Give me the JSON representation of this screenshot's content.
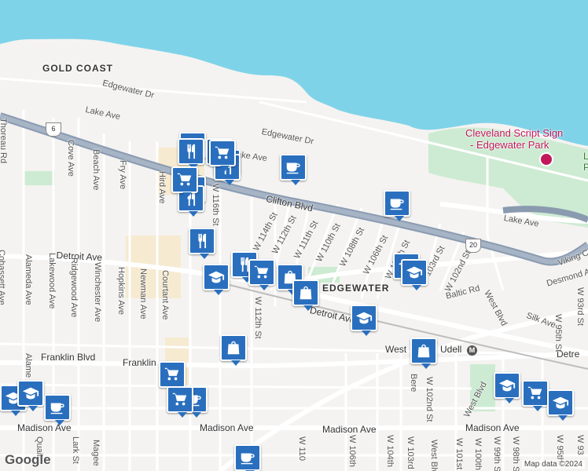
{
  "map": {
    "neighborhoods": [
      "GOLD COAST",
      "EDGEWATER"
    ],
    "poi": {
      "name": "Cleveland Script Sign - Edgewater Park",
      "line1": "Cleveland Script Sign",
      "line2": "- Edgewater Park"
    },
    "streets": {
      "edgewater_dr_1": "Edgewater Dr",
      "edgewater_dr_2": "Edgewater Dr",
      "lake_ave_1": "Lake Ave",
      "lake_ave_2": "Lake Ave",
      "lake_ave_3": "Lake Ave",
      "clifton_blvd": "Clifton Blvd",
      "detroit_ave_1": "Detroit Ave",
      "detroit_ave_2": "Detroit Ave",
      "detroit_ave_3": "Detroit Ave",
      "franklin_blvd_1": "Franklin Blvd",
      "franklin_blvd_2": "Franklin",
      "madison_ave_1": "Madison Ave",
      "madison_ave_2": "Madison Ave",
      "madison_ave_3": "Madison Ave",
      "madison_ave_4": "Madison Ave",
      "baltic_rd": "Baltic Rd",
      "viking": "Viking Cl",
      "desmond": "Desmond A",
      "silk": "Silk Ave",
      "w116": "W 116th St",
      "w114": "W 114th St",
      "w112": "W 112th St",
      "w112b": "W 112th St",
      "w111": "W 111th St",
      "w110": "W 110th St",
      "w108": "W 108th St",
      "w106": "W 106th St",
      "w105": "W 105th St",
      "w103": "W 103rd St",
      "w102": "W 102nd St",
      "west_blvd_1": "West Blvd",
      "west_blvd_2": "West Blvd",
      "w95": "W 95th St",
      "w93": "W 93rd St",
      "cove": "Cove Ave",
      "beach": "Beach Ave",
      "fry": "Fry Ave",
      "hird": "Hird Ave",
      "thoreau": "Thoreau Rd",
      "cohassett": "Cohassett Ave",
      "alameda": "Alameda Ave",
      "lakewood": "Lakewood Ave",
      "ridgewood": "Ridgewood Ave",
      "winchester": "Winchester Ave",
      "hopkins": "Hopkins Ave",
      "newman": "Newman Ave",
      "courtant": "Courtant Ave",
      "w112c": "W 112th St",
      "w110b": "W 110",
      "w106b": "W 106th",
      "w104": "W 104th",
      "w103b": "W 103rd",
      "w102b": "W 102nd St",
      "w101": "W 101st",
      "w100": "W 100th",
      "w99": "W 99th St",
      "w98": "W 98th St",
      "w95b": "W 95th",
      "w93b": "W 93",
      "lark": "Lark St",
      "magee": "Magee",
      "quail": "Quail",
      "alame": "Alame",
      "bere": "Bere",
      "west_blvd_3": "West Blvd",
      "west_label": "West",
      "udell": "Udell",
      "detre": "Detre",
      "w95c": "W 95th",
      "w93c": "W 93rd St"
    },
    "routes": [
      "6",
      "20"
    ],
    "markers": [
      {
        "type": "restaurant-icon"
      },
      {
        "type": "restaurant-icon"
      },
      {
        "type": "restaurant-icon"
      },
      {
        "type": "restaurant-icon"
      },
      {
        "type": "restaurant-icon"
      },
      {
        "type": "restaurant-icon"
      },
      {
        "type": "restaurant-icon"
      },
      {
        "type": "restaurant-icon"
      },
      {
        "type": "restaurant-icon"
      },
      {
        "type": "coffee-icon"
      },
      {
        "type": "coffee-icon"
      },
      {
        "type": "coffee-icon"
      },
      {
        "type": "coffee-icon"
      },
      {
        "type": "coffee-icon"
      },
      {
        "type": "shopping-cart-icon"
      },
      {
        "type": "shopping-cart-icon"
      },
      {
        "type": "shopping-cart-icon"
      },
      {
        "type": "shopping-cart-icon"
      },
      {
        "type": "shopping-cart-icon"
      },
      {
        "type": "shopping-cart-icon"
      },
      {
        "type": "shopping-bag-icon"
      },
      {
        "type": "shopping-bag-icon"
      },
      {
        "type": "shopping-bag-icon"
      },
      {
        "type": "shopping-bag-icon"
      },
      {
        "type": "school-icon"
      },
      {
        "type": "school-icon"
      },
      {
        "type": "school-icon"
      },
      {
        "type": "school-icon"
      },
      {
        "type": "school-icon"
      },
      {
        "type": "school-icon"
      },
      {
        "type": "school-icon"
      },
      {
        "type": "school-icon"
      }
    ],
    "logo": "Google",
    "attribution": "Map data ©2024",
    "metro": "M",
    "colors": {
      "water": "#7fd3e8",
      "park": "#cdebd2",
      "marker": "#2a6fbe",
      "highway": "#8a9bb0",
      "poi_text": "#c2185b"
    }
  }
}
